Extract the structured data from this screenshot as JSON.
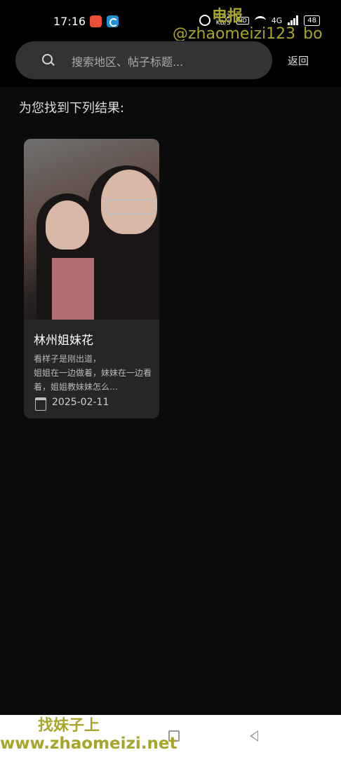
{
  "status_bar": {
    "time": "17:16",
    "net_speed_top": "0.02",
    "net_speed_bottom": "KB/S",
    "hd_label": "HD",
    "network_type": "4G",
    "battery": "48"
  },
  "watermark": {
    "top_line1": "电报",
    "top_line2": "@zhaomeizi123_bo",
    "bottom_line1": "找妹子上",
    "bottom_line2": "www.zhaomeizi.net"
  },
  "search": {
    "placeholder": "搜索地区、帖子标题...",
    "value": "",
    "back_label": "返回"
  },
  "results": {
    "title": "为您找到下列结果:",
    "items": [
      {
        "title": "林州姐妹花",
        "description": "看样子是刚出道，\n姐姐在一边做着，妹妹在一边看着，姐姐教妹妹怎么…",
        "date": "2025-02-11"
      }
    ]
  },
  "colors": {
    "background": "#0b0b0b",
    "search_box": "#333333",
    "card": "#262626",
    "watermark": "#a8a52b"
  }
}
